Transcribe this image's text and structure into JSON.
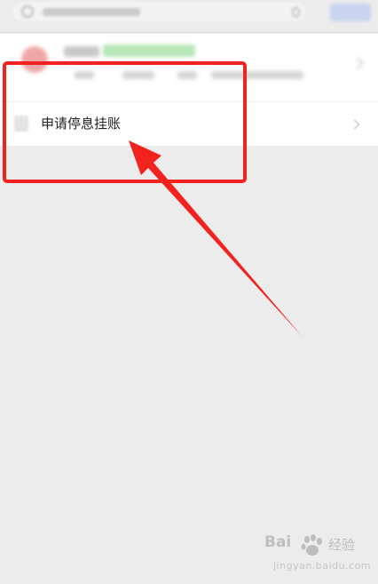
{
  "menu": {
    "item_label": "申请停息挂账"
  },
  "watermark": {
    "brand": "Bai",
    "brand_cn": "经验",
    "url": "jingyan.baidu.com"
  },
  "colors": {
    "annotation": "#f2231f",
    "background": "#ececec",
    "panel": "#ffffff"
  },
  "icons": {
    "search": "search-icon",
    "mic": "mic-icon",
    "chevron": "chevron-right-icon",
    "watermark_logo": "paw-icon"
  }
}
